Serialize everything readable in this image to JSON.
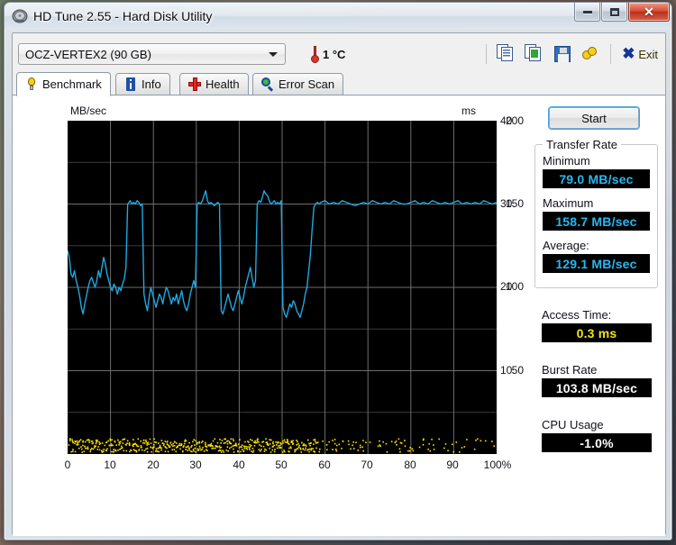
{
  "window": {
    "title": "HD Tune 2.55 - Hard Disk Utility",
    "icon": "hard-disk-icon",
    "minimize_label": "Minimize",
    "maximize_label": "Maximize",
    "close_label": "Close"
  },
  "toolbar": {
    "drive": "OCZ-VERTEX2 (90 GB)",
    "temperature": "1 °C",
    "icons": [
      {
        "name": "copy-icon",
        "label": "Copy"
      },
      {
        "name": "copy-screenshot-icon",
        "label": "Copy screenshot"
      },
      {
        "name": "save-icon",
        "label": "Save"
      },
      {
        "name": "options-icon",
        "label": "Options"
      }
    ],
    "exit_label": "Exit"
  },
  "tabs": [
    {
      "label": "Benchmark",
      "icon": "bulb-icon",
      "active": true
    },
    {
      "label": "Info",
      "icon": "info-icon",
      "active": false
    },
    {
      "label": "Health",
      "icon": "red-cross-icon",
      "active": false
    },
    {
      "label": "Error Scan",
      "icon": "magnifier-icon",
      "active": false
    }
  ],
  "side": {
    "start_label": "Start",
    "transfer_rate": {
      "group_title": "Transfer Rate",
      "minimum_label": "Minimum",
      "minimum_value": "79.0 MB/sec",
      "maximum_label": "Maximum",
      "maximum_value": "158.7 MB/sec",
      "average_label": "Average:",
      "average_value": "129.1 MB/sec"
    },
    "access_time_label": "Access Time:",
    "access_time_value": "0.3 ms",
    "burst_rate_label": "Burst Rate",
    "burst_rate_value": "103.8 MB/sec",
    "cpu_usage_label": "CPU Usage",
    "cpu_usage_value": "-1.0%"
  },
  "colors": {
    "transfer_curve": "#1fa8e0",
    "access_dots": "#ffe400",
    "plot_background": "#000000",
    "grid": "#6e6e6e",
    "value_cyan": "#2ab6ef",
    "value_yellow": "#f2e516",
    "value_white": "#ffffff"
  },
  "chart_data": {
    "type": "line",
    "title": "",
    "xlabel": "",
    "ylabel": "MB/sec",
    "y2label": "ms",
    "xlim": [
      0,
      100
    ],
    "ylim": [
      0,
      200
    ],
    "y2lim": [
      0,
      40
    ],
    "xticks": [
      "0",
      "10",
      "20",
      "30",
      "40",
      "50",
      "60",
      "70",
      "80",
      "90",
      "100%"
    ],
    "xtick_values": [
      0,
      10,
      20,
      30,
      40,
      50,
      60,
      70,
      80,
      90,
      100
    ],
    "yticks": [
      "50",
      "100",
      "150",
      "200"
    ],
    "ytick_values": [
      50,
      100,
      150,
      200
    ],
    "y2ticks": [
      "10",
      "20",
      "30",
      "40"
    ],
    "y2tick_values": [
      10,
      20,
      30,
      40
    ],
    "grid": true,
    "legend": "none",
    "series": [
      {
        "name": "Transfer rate",
        "axis": "left",
        "unit": "MB/sec",
        "color": "#1fa8e0",
        "x": [
          0.0,
          0.4,
          0.8,
          1.2,
          1.6,
          2.0,
          2.4,
          2.8,
          3.2,
          3.6,
          4.0,
          4.4,
          4.8,
          5.2,
          5.6,
          6.0,
          6.4,
          6.8,
          7.2,
          7.6,
          8.0,
          8.4,
          8.8,
          9.2,
          9.6,
          10.0,
          10.4,
          10.8,
          11.2,
          11.6,
          12.0,
          12.4,
          12.8,
          13.2,
          13.6,
          14.0,
          14.3,
          14.6,
          15.0,
          15.4,
          15.8,
          16.2,
          16.6,
          17.0,
          17.4,
          17.8,
          18.2,
          18.6,
          19.0,
          19.4,
          19.8,
          20.2,
          20.6,
          21.0,
          21.4,
          21.8,
          22.2,
          22.6,
          23.0,
          23.4,
          23.8,
          24.2,
          24.6,
          25.0,
          25.4,
          25.8,
          26.2,
          26.6,
          27.0,
          27.4,
          27.8,
          28.2,
          28.6,
          29.0,
          29.4,
          29.8,
          30.2,
          30.6,
          31.0,
          31.4,
          31.8,
          32.2,
          32.6,
          33.0,
          33.4,
          33.8,
          34.2,
          34.6,
          35.0,
          35.4,
          35.8,
          36.2,
          36.6,
          37.0,
          37.4,
          37.8,
          38.2,
          38.6,
          39.0,
          39.4,
          39.8,
          40.2,
          40.6,
          41.0,
          41.4,
          41.8,
          42.2,
          42.6,
          43.0,
          43.4,
          43.8,
          44.2,
          44.6,
          45.0,
          45.4,
          45.8,
          46.2,
          46.6,
          47.0,
          47.4,
          47.8,
          48.2,
          48.6,
          49.0,
          49.4,
          49.8,
          50.2,
          50.6,
          51.0,
          51.4,
          51.8,
          52.2,
          52.6,
          53.0,
          53.4,
          53.8,
          54.2,
          54.6,
          55.0,
          55.4,
          55.8,
          56.2,
          56.6,
          57.0,
          57.4,
          57.8,
          58.2,
          58.6,
          59.0,
          60.0,
          61.0,
          62.0,
          63.0,
          64.0,
          65.0,
          66.0,
          67.0,
          68.0,
          69.0,
          70.0,
          71.0,
          72.0,
          73.0,
          74.0,
          75.0,
          76.0,
          77.0,
          78.0,
          79.0,
          80.0,
          81.0,
          82.0,
          83.0,
          84.0,
          85.0,
          86.0,
          87.0,
          88.0,
          89.0,
          90.0,
          91.0,
          92.0,
          93.0,
          94.0,
          95.0,
          96.0,
          97.0,
          98.0,
          99.0,
          100.0
        ],
        "y": [
          122,
          118,
          108,
          106,
          110,
          104,
          100,
          95,
          88,
          84,
          90,
          95,
          100,
          104,
          106,
          103,
          100,
          104,
          110,
          106,
          112,
          118,
          114,
          108,
          104,
          100,
          98,
          102,
          100,
          96,
          100,
          98,
          102,
          105,
          112,
          150,
          151,
          152,
          150,
          151,
          150,
          152,
          151,
          149,
          150,
          96,
          90,
          86,
          94,
          100,
          96,
          92,
          88,
          92,
          96,
          94,
          90,
          96,
          100,
          98,
          94,
          90,
          94,
          92,
          96,
          90,
          94,
          98,
          92,
          88,
          86,
          90,
          96,
          100,
          104,
          100,
          150,
          151,
          150,
          152,
          155,
          158,
          152,
          150,
          151,
          150,
          149,
          150,
          151,
          150,
          86,
          84,
          88,
          92,
          96,
          92,
          88,
          86,
          90,
          94,
          98,
          94,
          90,
          94,
          100,
          104,
          108,
          112,
          106,
          100,
          104,
          150,
          152,
          151,
          154,
          158,
          156,
          155,
          152,
          150,
          151,
          152,
          150,
          151,
          150,
          152,
          88,
          84,
          82,
          86,
          90,
          88,
          92,
          90,
          86,
          84,
          82,
          86,
          90,
          96,
          100,
          110,
          120,
          135,
          148,
          150,
          151,
          150,
          151,
          152,
          150,
          151,
          150,
          152,
          151,
          150,
          149,
          150,
          151,
          150,
          152,
          151,
          150,
          151,
          150,
          152,
          151,
          150,
          150,
          151,
          152,
          150,
          151,
          150,
          152,
          151,
          150,
          151,
          150,
          151,
          152,
          150,
          151,
          150,
          151,
          150,
          152,
          151,
          150,
          151
        ]
      },
      {
        "name": "Access time",
        "axis": "right",
        "unit": "ms",
        "color": "#ffe400",
        "typical_value": 0.3,
        "note": "dense scatter of access time samples near 0.3 ms along the bottom of the plot"
      }
    ]
  }
}
